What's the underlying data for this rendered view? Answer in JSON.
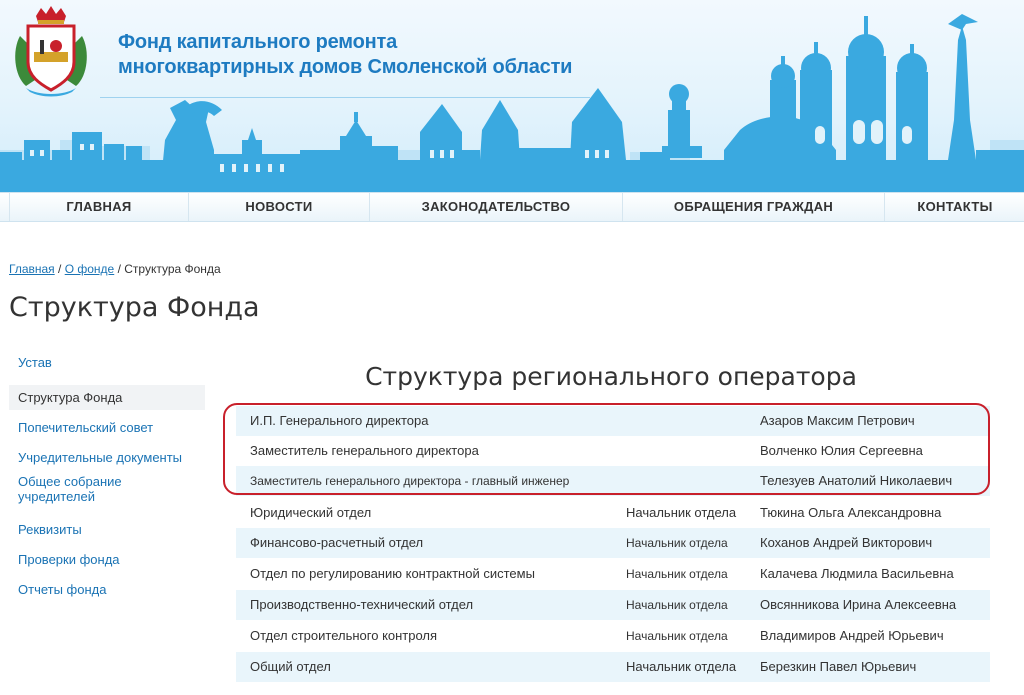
{
  "header": {
    "title_line1": "Фонд капитального ремонта",
    "title_line2": "многоквартирных домов Смоленской области",
    "colors": {
      "title": "#1e7bc1",
      "skyline": "#3aa9e0",
      "accent_red": "#c8202b"
    }
  },
  "nav": [
    {
      "label": "ГЛАВНАЯ"
    },
    {
      "label": "НОВОСТИ"
    },
    {
      "label": "ЗАКОНОДАТЕЛЬСТВО"
    },
    {
      "label": "ОБРАЩЕНИЯ ГРАЖДАН"
    },
    {
      "label": "КОНТАКТЫ"
    }
  ],
  "breadcrumb": {
    "home": "Главная",
    "sep1": " / ",
    "about": "О фонде",
    "sep2": " / ",
    "current": "Структура Фонда"
  },
  "page_title": "Структура Фонда",
  "sidebar": [
    {
      "label": "Устав"
    },
    {
      "label": "Структура Фонда"
    },
    {
      "label": "Попечительский совет"
    },
    {
      "label": "Учредительные документы"
    },
    {
      "label": "Общее собрание учредителей"
    },
    {
      "label": "Реквизиты"
    },
    {
      "label": "Проверки фонда"
    },
    {
      "label": "Отчеты фонда"
    }
  ],
  "section_title": "Структура регионального оператора",
  "rows": [
    {
      "unit": "И.П. Генерального директора",
      "position": "",
      "person": "Азаров Максим Петрович"
    },
    {
      "unit": "Заместитель генерального директора",
      "position": "",
      "person": "Волченко Юлия Сергеевна"
    },
    {
      "unit": "Заместитель генерального директора - главный инженер",
      "position": "",
      "person": "Телезуев Анатолий Николаевич"
    },
    {
      "unit": "Юридический отдел",
      "position": "Начальник отдела",
      "person": "Тюкина Ольга Александровна"
    },
    {
      "unit": "Финансово-расчетный отдел",
      "position": "Начальник отдела",
      "person": "Коханов Андрей Викторович"
    },
    {
      "unit": "Отдел по регулированию контрактной системы",
      "position": "Начальник отдела",
      "person": "Калачева Людмила Васильевна"
    },
    {
      "unit": "Производственно-технический отдел",
      "position": "Начальник отдела",
      "person": "Овсянникова Ирина Алексеевна"
    },
    {
      "unit": "Отдел строительного контроля",
      "position": "Начальник отдела",
      "person": "Владимиров Андрей Юрьевич"
    },
    {
      "unit": "Общий отдел",
      "position": "Начальник отдела",
      "person": "Березкин Павел Юрьевич"
    }
  ]
}
